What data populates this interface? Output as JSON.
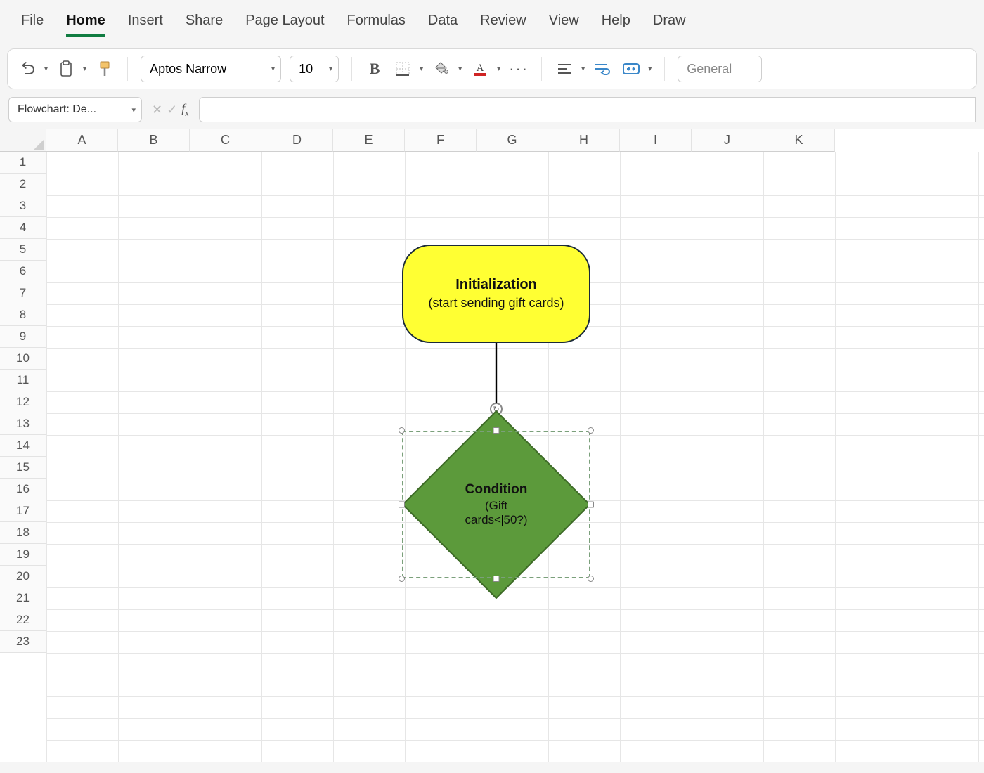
{
  "tabs": [
    "File",
    "Home",
    "Insert",
    "Share",
    "Page Layout",
    "Formulas",
    "Data",
    "Review",
    "View",
    "Help",
    "Draw"
  ],
  "active_tab": "Home",
  "toolbar": {
    "font_name": "Aptos Narrow",
    "font_size": "10",
    "number_format": "General"
  },
  "namebox": "Flowchart: De...",
  "columns": [
    "A",
    "B",
    "C",
    "D",
    "E",
    "F",
    "G",
    "H",
    "I",
    "J",
    "K"
  ],
  "rows": [
    "1",
    "2",
    "3",
    "4",
    "5",
    "6",
    "7",
    "8",
    "9",
    "10",
    "11",
    "12",
    "13",
    "14",
    "15",
    "16",
    "17",
    "18",
    "19",
    "20",
    "21",
    "22",
    "23"
  ],
  "shapes": {
    "terminator": {
      "title": "Initialization",
      "subtitle": "(start sending gift cards)"
    },
    "decision": {
      "title": "Condition",
      "line2_pre": "(Gift",
      "line3_pre": "cards<",
      "line3_post": "50?)"
    }
  }
}
